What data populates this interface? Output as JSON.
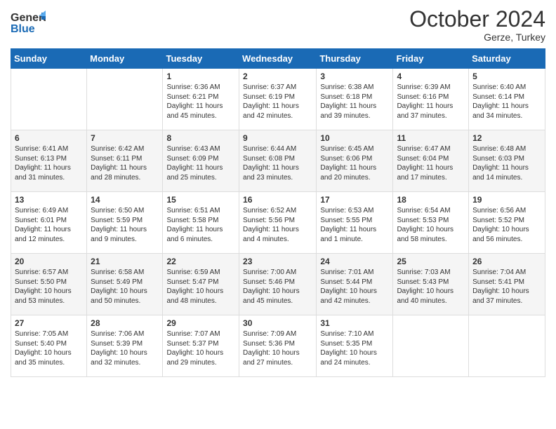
{
  "logo": {
    "text_general": "General",
    "text_blue": "Blue"
  },
  "title": {
    "month_year": "October 2024",
    "location": "Gerze, Turkey"
  },
  "weekdays": [
    "Sunday",
    "Monday",
    "Tuesday",
    "Wednesday",
    "Thursday",
    "Friday",
    "Saturday"
  ],
  "weeks": [
    [
      {
        "day": "",
        "sunrise": "",
        "sunset": "",
        "daylight": ""
      },
      {
        "day": "",
        "sunrise": "",
        "sunset": "",
        "daylight": ""
      },
      {
        "day": "1",
        "sunrise": "Sunrise: 6:36 AM",
        "sunset": "Sunset: 6:21 PM",
        "daylight": "Daylight: 11 hours and 45 minutes."
      },
      {
        "day": "2",
        "sunrise": "Sunrise: 6:37 AM",
        "sunset": "Sunset: 6:19 PM",
        "daylight": "Daylight: 11 hours and 42 minutes."
      },
      {
        "day": "3",
        "sunrise": "Sunrise: 6:38 AM",
        "sunset": "Sunset: 6:18 PM",
        "daylight": "Daylight: 11 hours and 39 minutes."
      },
      {
        "day": "4",
        "sunrise": "Sunrise: 6:39 AM",
        "sunset": "Sunset: 6:16 PM",
        "daylight": "Daylight: 11 hours and 37 minutes."
      },
      {
        "day": "5",
        "sunrise": "Sunrise: 6:40 AM",
        "sunset": "Sunset: 6:14 PM",
        "daylight": "Daylight: 11 hours and 34 minutes."
      }
    ],
    [
      {
        "day": "6",
        "sunrise": "Sunrise: 6:41 AM",
        "sunset": "Sunset: 6:13 PM",
        "daylight": "Daylight: 11 hours and 31 minutes."
      },
      {
        "day": "7",
        "sunrise": "Sunrise: 6:42 AM",
        "sunset": "Sunset: 6:11 PM",
        "daylight": "Daylight: 11 hours and 28 minutes."
      },
      {
        "day": "8",
        "sunrise": "Sunrise: 6:43 AM",
        "sunset": "Sunset: 6:09 PM",
        "daylight": "Daylight: 11 hours and 25 minutes."
      },
      {
        "day": "9",
        "sunrise": "Sunrise: 6:44 AM",
        "sunset": "Sunset: 6:08 PM",
        "daylight": "Daylight: 11 hours and 23 minutes."
      },
      {
        "day": "10",
        "sunrise": "Sunrise: 6:45 AM",
        "sunset": "Sunset: 6:06 PM",
        "daylight": "Daylight: 11 hours and 20 minutes."
      },
      {
        "day": "11",
        "sunrise": "Sunrise: 6:47 AM",
        "sunset": "Sunset: 6:04 PM",
        "daylight": "Daylight: 11 hours and 17 minutes."
      },
      {
        "day": "12",
        "sunrise": "Sunrise: 6:48 AM",
        "sunset": "Sunset: 6:03 PM",
        "daylight": "Daylight: 11 hours and 14 minutes."
      }
    ],
    [
      {
        "day": "13",
        "sunrise": "Sunrise: 6:49 AM",
        "sunset": "Sunset: 6:01 PM",
        "daylight": "Daylight: 11 hours and 12 minutes."
      },
      {
        "day": "14",
        "sunrise": "Sunrise: 6:50 AM",
        "sunset": "Sunset: 5:59 PM",
        "daylight": "Daylight: 11 hours and 9 minutes."
      },
      {
        "day": "15",
        "sunrise": "Sunrise: 6:51 AM",
        "sunset": "Sunset: 5:58 PM",
        "daylight": "Daylight: 11 hours and 6 minutes."
      },
      {
        "day": "16",
        "sunrise": "Sunrise: 6:52 AM",
        "sunset": "Sunset: 5:56 PM",
        "daylight": "Daylight: 11 hours and 4 minutes."
      },
      {
        "day": "17",
        "sunrise": "Sunrise: 6:53 AM",
        "sunset": "Sunset: 5:55 PM",
        "daylight": "Daylight: 11 hours and 1 minute."
      },
      {
        "day": "18",
        "sunrise": "Sunrise: 6:54 AM",
        "sunset": "Sunset: 5:53 PM",
        "daylight": "Daylight: 10 hours and 58 minutes."
      },
      {
        "day": "19",
        "sunrise": "Sunrise: 6:56 AM",
        "sunset": "Sunset: 5:52 PM",
        "daylight": "Daylight: 10 hours and 56 minutes."
      }
    ],
    [
      {
        "day": "20",
        "sunrise": "Sunrise: 6:57 AM",
        "sunset": "Sunset: 5:50 PM",
        "daylight": "Daylight: 10 hours and 53 minutes."
      },
      {
        "day": "21",
        "sunrise": "Sunrise: 6:58 AM",
        "sunset": "Sunset: 5:49 PM",
        "daylight": "Daylight: 10 hours and 50 minutes."
      },
      {
        "day": "22",
        "sunrise": "Sunrise: 6:59 AM",
        "sunset": "Sunset: 5:47 PM",
        "daylight": "Daylight: 10 hours and 48 minutes."
      },
      {
        "day": "23",
        "sunrise": "Sunrise: 7:00 AM",
        "sunset": "Sunset: 5:46 PM",
        "daylight": "Daylight: 10 hours and 45 minutes."
      },
      {
        "day": "24",
        "sunrise": "Sunrise: 7:01 AM",
        "sunset": "Sunset: 5:44 PM",
        "daylight": "Daylight: 10 hours and 42 minutes."
      },
      {
        "day": "25",
        "sunrise": "Sunrise: 7:03 AM",
        "sunset": "Sunset: 5:43 PM",
        "daylight": "Daylight: 10 hours and 40 minutes."
      },
      {
        "day": "26",
        "sunrise": "Sunrise: 7:04 AM",
        "sunset": "Sunset: 5:41 PM",
        "daylight": "Daylight: 10 hours and 37 minutes."
      }
    ],
    [
      {
        "day": "27",
        "sunrise": "Sunrise: 7:05 AM",
        "sunset": "Sunset: 5:40 PM",
        "daylight": "Daylight: 10 hours and 35 minutes."
      },
      {
        "day": "28",
        "sunrise": "Sunrise: 7:06 AM",
        "sunset": "Sunset: 5:39 PM",
        "daylight": "Daylight: 10 hours and 32 minutes."
      },
      {
        "day": "29",
        "sunrise": "Sunrise: 7:07 AM",
        "sunset": "Sunset: 5:37 PM",
        "daylight": "Daylight: 10 hours and 29 minutes."
      },
      {
        "day": "30",
        "sunrise": "Sunrise: 7:09 AM",
        "sunset": "Sunset: 5:36 PM",
        "daylight": "Daylight: 10 hours and 27 minutes."
      },
      {
        "day": "31",
        "sunrise": "Sunrise: 7:10 AM",
        "sunset": "Sunset: 5:35 PM",
        "daylight": "Daylight: 10 hours and 24 minutes."
      },
      {
        "day": "",
        "sunrise": "",
        "sunset": "",
        "daylight": ""
      },
      {
        "day": "",
        "sunrise": "",
        "sunset": "",
        "daylight": ""
      }
    ]
  ]
}
